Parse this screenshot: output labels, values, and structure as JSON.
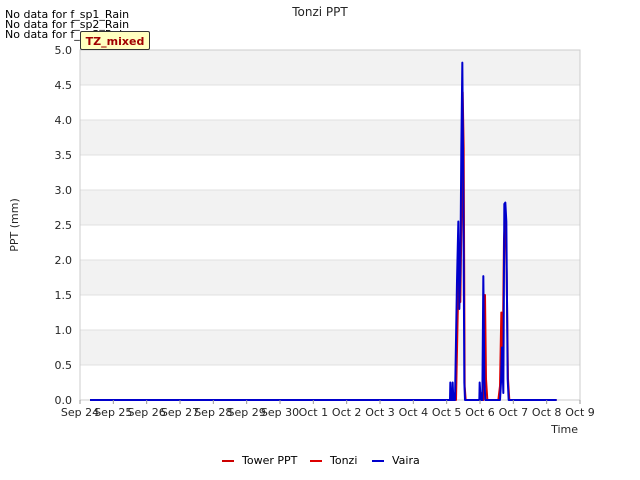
{
  "no_data_messages": [
    "No data for f_sp1_Rain",
    "No data for f_sp2_Rain",
    "No data for f_sp3_Rain"
  ],
  "badge": "TZ_mixed",
  "colors": {
    "tower": "#cc0000",
    "tonzi": "#dd0000",
    "vaira": "#0000cc",
    "band": "#f2f2f2"
  },
  "chart_data": {
    "type": "line",
    "title": "Tonzi PPT",
    "xlabel": "Time",
    "ylabel": "PPT (mm)",
    "xlim": [
      0,
      15
    ],
    "ylim": [
      0,
      5.0
    ],
    "x_ticks": [
      "Sep 24",
      "Sep 25",
      "Sep 26",
      "Sep 27",
      "Sep 28",
      "Sep 29",
      "Sep 30",
      "Oct 1",
      "Oct 2",
      "Oct 3",
      "Oct 4",
      "Oct 5",
      "Oct 6",
      "Oct 7",
      "Oct 8",
      "Oct 9"
    ],
    "y_ticks": [
      "0.0",
      "0.5",
      "1.0",
      "1.5",
      "2.0",
      "2.5",
      "3.0",
      "3.5",
      "4.0",
      "4.5",
      "5.0"
    ],
    "legend": "bottom-center",
    "grid": true,
    "series": [
      {
        "name": "Tower PPT",
        "color": "#cc0000",
        "points": []
      },
      {
        "name": "Tonzi",
        "color": "#dd0000",
        "points": [
          [
            0.3,
            0
          ],
          [
            11.2,
            0
          ],
          [
            11.25,
            0.1
          ],
          [
            11.28,
            0
          ],
          [
            11.33,
            1.2
          ],
          [
            11.38,
            2.1
          ],
          [
            11.41,
            1.4
          ],
          [
            11.45,
            2.8
          ],
          [
            11.48,
            4.4
          ],
          [
            11.51,
            3.6
          ],
          [
            11.54,
            0.2
          ],
          [
            11.57,
            0
          ],
          [
            12.0,
            0
          ],
          [
            12.05,
            0.1
          ],
          [
            12.1,
            0
          ],
          [
            12.15,
            1.5
          ],
          [
            12.18,
            0.3
          ],
          [
            12.22,
            0
          ],
          [
            12.55,
            0
          ],
          [
            12.6,
            0.2
          ],
          [
            12.64,
            1.25
          ],
          [
            12.68,
            0.6
          ],
          [
            12.72,
            2.3
          ],
          [
            12.76,
            2.6
          ],
          [
            12.8,
            1.8
          ],
          [
            12.84,
            0.3
          ],
          [
            12.88,
            0
          ],
          [
            14.3,
            0
          ]
        ]
      },
      {
        "name": "Vaira",
        "color": "#0000cc",
        "points": [
          [
            0.3,
            0
          ],
          [
            11.1,
            0
          ],
          [
            11.11,
            0.25
          ],
          [
            11.13,
            0
          ],
          [
            11.17,
            0
          ],
          [
            11.18,
            0.25
          ],
          [
            11.2,
            0
          ],
          [
            11.25,
            0
          ],
          [
            11.31,
            1.7
          ],
          [
            11.35,
            2.55
          ],
          [
            11.38,
            1.3
          ],
          [
            11.41,
            1.8
          ],
          [
            11.44,
            3.6
          ],
          [
            11.47,
            4.82
          ],
          [
            11.5,
            3.0
          ],
          [
            11.53,
            0.25
          ],
          [
            11.55,
            0
          ],
          [
            11.98,
            0
          ],
          [
            11.99,
            0.25
          ],
          [
            12.02,
            0
          ],
          [
            12.07,
            0
          ],
          [
            12.1,
            1.77
          ],
          [
            12.13,
            0.3
          ],
          [
            12.16,
            0
          ],
          [
            12.6,
            0
          ],
          [
            12.63,
            0.25
          ],
          [
            12.66,
            0.75
          ],
          [
            12.7,
            0.1
          ],
          [
            12.73,
            2.8
          ],
          [
            12.76,
            2.82
          ],
          [
            12.79,
            2.55
          ],
          [
            12.83,
            0.3
          ],
          [
            12.86,
            0
          ],
          [
            14.3,
            0
          ]
        ]
      }
    ]
  }
}
